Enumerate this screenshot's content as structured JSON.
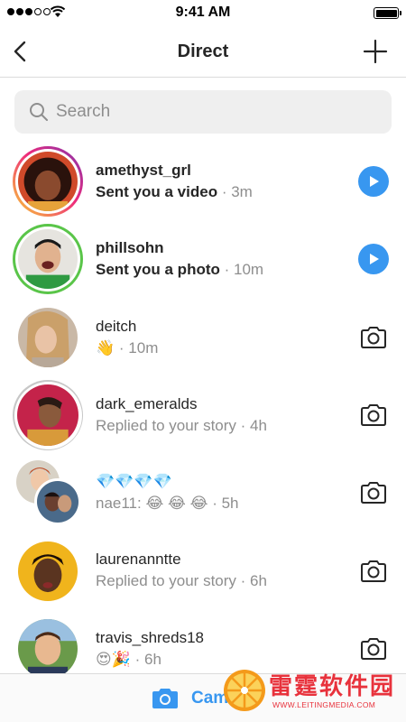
{
  "status_bar": {
    "time": "9:41 AM"
  },
  "header": {
    "title": "Direct"
  },
  "search": {
    "placeholder": "Search"
  },
  "threads": [
    {
      "username": "amethyst_grl",
      "preview": "Sent you a video",
      "time": " · 3m",
      "unread": true,
      "action": "play"
    },
    {
      "username": "phillsohn",
      "preview": "Sent you a photo",
      "time": " · 10m",
      "unread": true,
      "action": "play"
    },
    {
      "username": "deitch",
      "preview": "👋",
      "time": " · 10m",
      "unread": false,
      "action": "camera"
    },
    {
      "username": "dark_emeralds",
      "preview": "Replied to your story",
      "time": " · 4h",
      "unread": false,
      "action": "camera"
    },
    {
      "username": "💎💎💎💎",
      "preview": "nae11: 😂 😂 😂",
      "time": " · 5h",
      "unread": false,
      "action": "camera"
    },
    {
      "username": "laurenanntte",
      "preview": "Replied to your story",
      "time": " · 6h",
      "unread": false,
      "action": "camera"
    },
    {
      "username": "travis_shreds18",
      "preview": "😍🎉",
      "time": " · 6h",
      "unread": false,
      "action": "camera"
    }
  ],
  "bottom_bar": {
    "camera_label": "Cam"
  },
  "watermark": {
    "brand_cn": "雷霆软件园",
    "brand_url": "WWW.LEITINGMEDIA.COM"
  },
  "colors": {
    "accent": "#3897f0",
    "story_green": "#5ac549",
    "text": "#262626",
    "secondary_text": "#8e8e8e"
  }
}
